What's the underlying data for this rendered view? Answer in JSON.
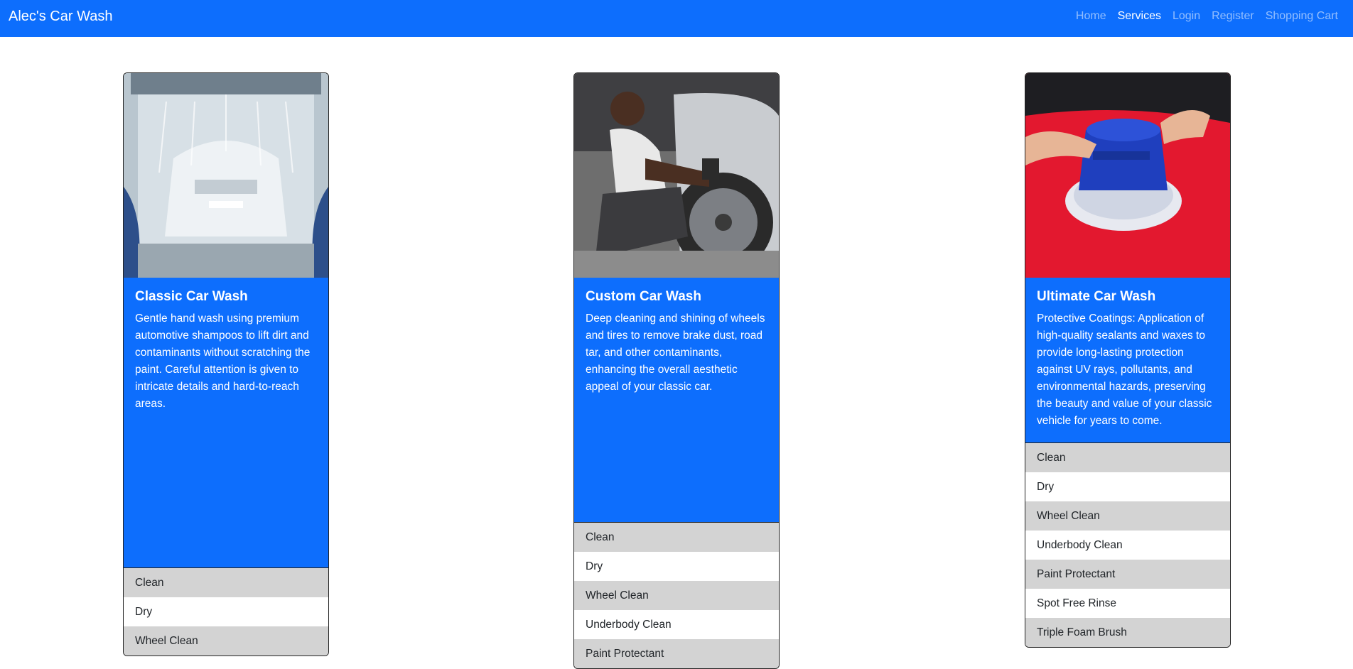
{
  "navbar": {
    "brand": "Alec's Car Wash",
    "links": [
      {
        "label": "Home"
      },
      {
        "label": "Services"
      },
      {
        "label": "Login"
      },
      {
        "label": "Register"
      },
      {
        "label": "Shopping Cart"
      }
    ],
    "active": "Services",
    "bg_color": "#0d6efd"
  },
  "cards": [
    {
      "image": "car-in-automatic-wash-tunnel-photo",
      "title": "Classic Car Wash",
      "text": "Gentle hand wash using premium automotive shampoos to lift dirt and contaminants without scratching the paint. Careful attention is given to intricate details and hard-to-reach areas.",
      "features": [
        "Clean",
        "Dry",
        "Wheel Clean"
      ]
    },
    {
      "image": "man-cleaning-car-wheel-photo",
      "title": "Custom Car Wash",
      "text": "Deep cleaning and shining of wheels and tires to remove brake dust, road tar, and other contaminants, enhancing the overall aesthetic appeal of your classic car.",
      "features": [
        "Clean",
        "Dry",
        "Wheel Clean",
        "Underbody Clean",
        "Paint Protectant"
      ]
    },
    {
      "image": "polisher-on-red-car-hood-photo",
      "title": "Ultimate Car Wash",
      "text": "Protective Coatings: Application of high-quality sealants and waxes to provide long-lasting protection against UV rays, pollutants, and environmental hazards, preserving the beauty and value of your classic vehicle for years to come.",
      "features": [
        "Clean",
        "Dry",
        "Wheel Clean",
        "Underbody Clean",
        "Paint Protectant",
        "Spot Free Rinse",
        "Triple Foam Brush"
      ]
    }
  ]
}
